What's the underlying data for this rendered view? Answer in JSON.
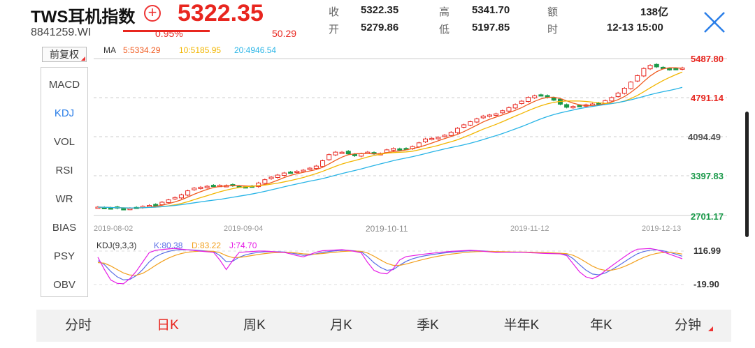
{
  "header": {
    "name": "TWS耳机指数",
    "code": "8841259.WI",
    "price": "5322.35",
    "change_pct": "0.95%",
    "change": "50.29",
    "stats": [
      {
        "label": "收",
        "value": "5322.35"
      },
      {
        "label": "开",
        "value": "5279.86"
      },
      {
        "label": "高",
        "value": "5341.70"
      },
      {
        "label": "低",
        "value": "5197.85"
      },
      {
        "label": "额",
        "value": "138亿"
      },
      {
        "label": "时",
        "value": "12-13 15:00"
      }
    ]
  },
  "toolbar": {
    "adjust_label": "前复权",
    "indicators": [
      "MACD",
      "KDJ",
      "VOL",
      "RSI",
      "WR",
      "BIAS",
      "PSY",
      "OBV"
    ],
    "active_indicator": "KDJ"
  },
  "main_chart": {
    "ma_label": "MA",
    "ma": [
      {
        "label": "5:5334.29",
        "color": "#f05a1e"
      },
      {
        "label": "10:5185.95",
        "color": "#f2b600"
      },
      {
        "label": "20:4946.54",
        "color": "#28b4e6"
      }
    ],
    "y_labels": [
      "5487.80",
      "4791.14",
      "4094.49",
      "3397.83",
      "2701.17"
    ],
    "dates": [
      "2019-08-02",
      "2019-09-04",
      "2019-10-11",
      "2019-11-12",
      "2019-12-13"
    ]
  },
  "kdj_chart": {
    "title": "KDJ(9,3,3)",
    "k_label": "K:80.38",
    "d_label": "D:83.22",
    "j_label": "J:74.70",
    "y_labels": [
      "116.99",
      "-19.90"
    ]
  },
  "tabs": [
    "分时",
    "日K",
    "周K",
    "月K",
    "季K",
    "半年K",
    "年K",
    "分钟"
  ],
  "active_tab": "日K",
  "colors": {
    "up": "#e8261f",
    "down": "#1a9a4a",
    "ma5": "#f05a1e",
    "ma10": "#f2b600",
    "ma20": "#28b4e6",
    "k": "#5a6ee6",
    "d": "#f2a01e",
    "j": "#e61ee6"
  },
  "chart_data": [
    {
      "type": "line",
      "title": "",
      "x": [
        "2019-08-02",
        "2019-09-04",
        "2019-10-11",
        "2019-11-12",
        "2019-12-13"
      ],
      "ylim": [
        2701.17,
        5487.8
      ],
      "series": [
        {
          "name": "MA5",
          "values": [
            2880,
            3300,
            3930,
            4650,
            5334.29
          ]
        },
        {
          "name": "MA10",
          "values": [
            2850,
            3240,
            3900,
            4550,
            5185.95
          ]
        },
        {
          "name": "MA20",
          "values": [
            2790,
            3150,
            3850,
            4400,
            4946.54
          ]
        }
      ]
    },
    {
      "type": "line",
      "title": "KDJ(9,3,3)",
      "x": [
        "2019-08-02",
        "2019-09-04",
        "2019-10-11",
        "2019-11-12",
        "2019-12-13"
      ],
      "ylim": [
        -19.9,
        116.99
      ],
      "series": [
        {
          "name": "K",
          "values": [
            40,
            70,
            85,
            95,
            80.38
          ]
        },
        {
          "name": "D",
          "values": [
            35,
            65,
            80,
            92,
            83.22
          ]
        },
        {
          "name": "J",
          "values": [
            -10,
            85,
            100,
            105,
            74.7
          ]
        }
      ]
    }
  ]
}
